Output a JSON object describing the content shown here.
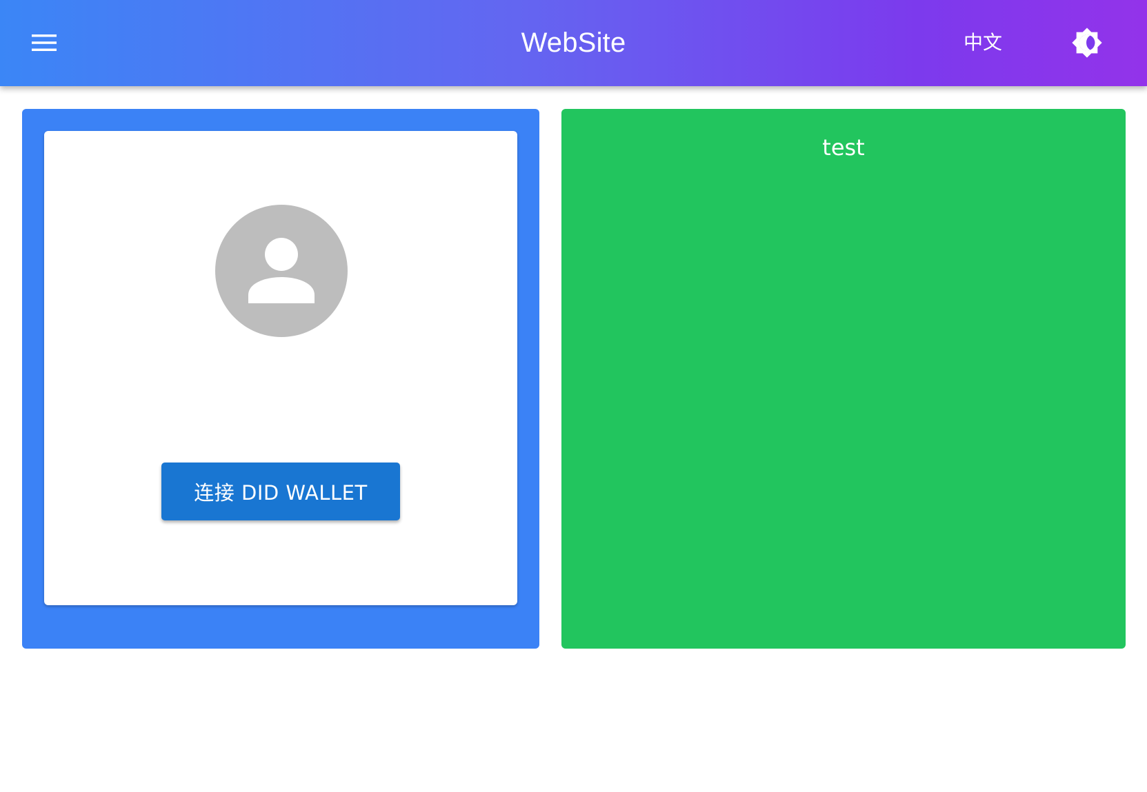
{
  "header": {
    "menu_icon": "hamburger-menu-icon",
    "title": "WebSite",
    "language_label": "中文",
    "theme_icon": "brightness-auto-icon",
    "gradient_colors": [
      "#3b86f6",
      "#6366f1",
      "#7c3aed",
      "#9333ea"
    ]
  },
  "left_panel": {
    "background_color": "#3b82f6",
    "card": {
      "avatar_icon": "user-avatar-placeholder-icon",
      "connect_button_label": "连接 DID WALLET",
      "connect_button_color": "#1976d2"
    }
  },
  "right_panel": {
    "background_color": "#22c55e",
    "title": "test"
  }
}
